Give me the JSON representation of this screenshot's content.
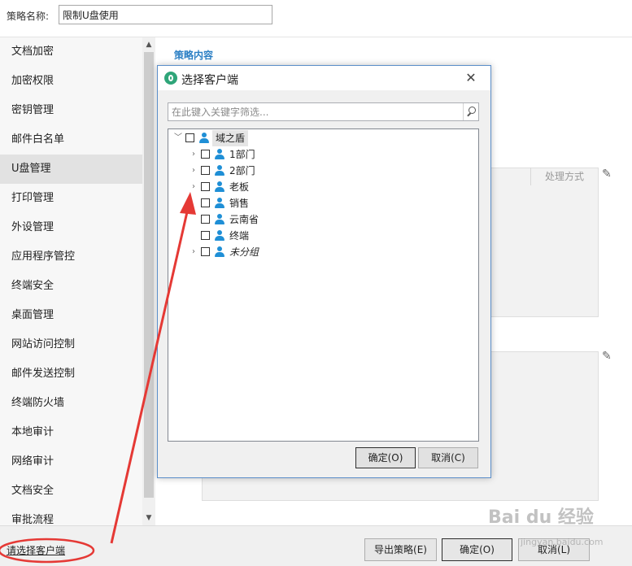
{
  "policy": {
    "name_label": "策略名称:",
    "name_value": "限制U盘使用"
  },
  "sidebar": {
    "items": [
      {
        "label": "文档加密"
      },
      {
        "label": "加密权限"
      },
      {
        "label": "密钥管理"
      },
      {
        "label": "邮件白名单"
      },
      {
        "label": "U盘管理"
      },
      {
        "label": "打印管理"
      },
      {
        "label": "外设管理"
      },
      {
        "label": "应用程序管控"
      },
      {
        "label": "终端安全"
      },
      {
        "label": "桌面管理"
      },
      {
        "label": "网站访问控制"
      },
      {
        "label": "邮件发送控制"
      },
      {
        "label": "终端防火墙"
      },
      {
        "label": "本地审计"
      },
      {
        "label": "网络审计"
      },
      {
        "label": "文档安全"
      },
      {
        "label": "审批流程"
      }
    ],
    "active_index": 4
  },
  "main": {
    "section_title": "策略内容",
    "column_header": "处理方式",
    "section_title_2": "处理方式"
  },
  "dialog": {
    "title": "选择客户端",
    "close_glyph": "✕",
    "filter_placeholder": "在此键入关键字筛选...",
    "tree": [
      {
        "label": "域之盾",
        "expander": "﹀"
      },
      {
        "label": "1部门",
        "expander": "›"
      },
      {
        "label": "2部门",
        "expander": "›"
      },
      {
        "label": "老板",
        "expander": "›"
      },
      {
        "label": "销售",
        "expander": ""
      },
      {
        "label": "云南省",
        "expander": ""
      },
      {
        "label": "终端",
        "expander": ""
      },
      {
        "label": "未分组",
        "expander": "›"
      }
    ],
    "ok_label": "确定(O)",
    "cancel_label": "取消(C)"
  },
  "bottom": {
    "client_link": "请选择客户端",
    "export_label": "导出策略(E)",
    "ok_label": "确定(O)",
    "cancel_label": "取消(L)"
  },
  "watermark": {
    "text": "Bai du 经验",
    "sub": "jingyan.baidu.com"
  },
  "colors": {
    "accent": "#2b7fc4",
    "annotation": "#e53935",
    "dialog_border": "#5b8ec9",
    "user_icon": "#1f8fd6"
  }
}
